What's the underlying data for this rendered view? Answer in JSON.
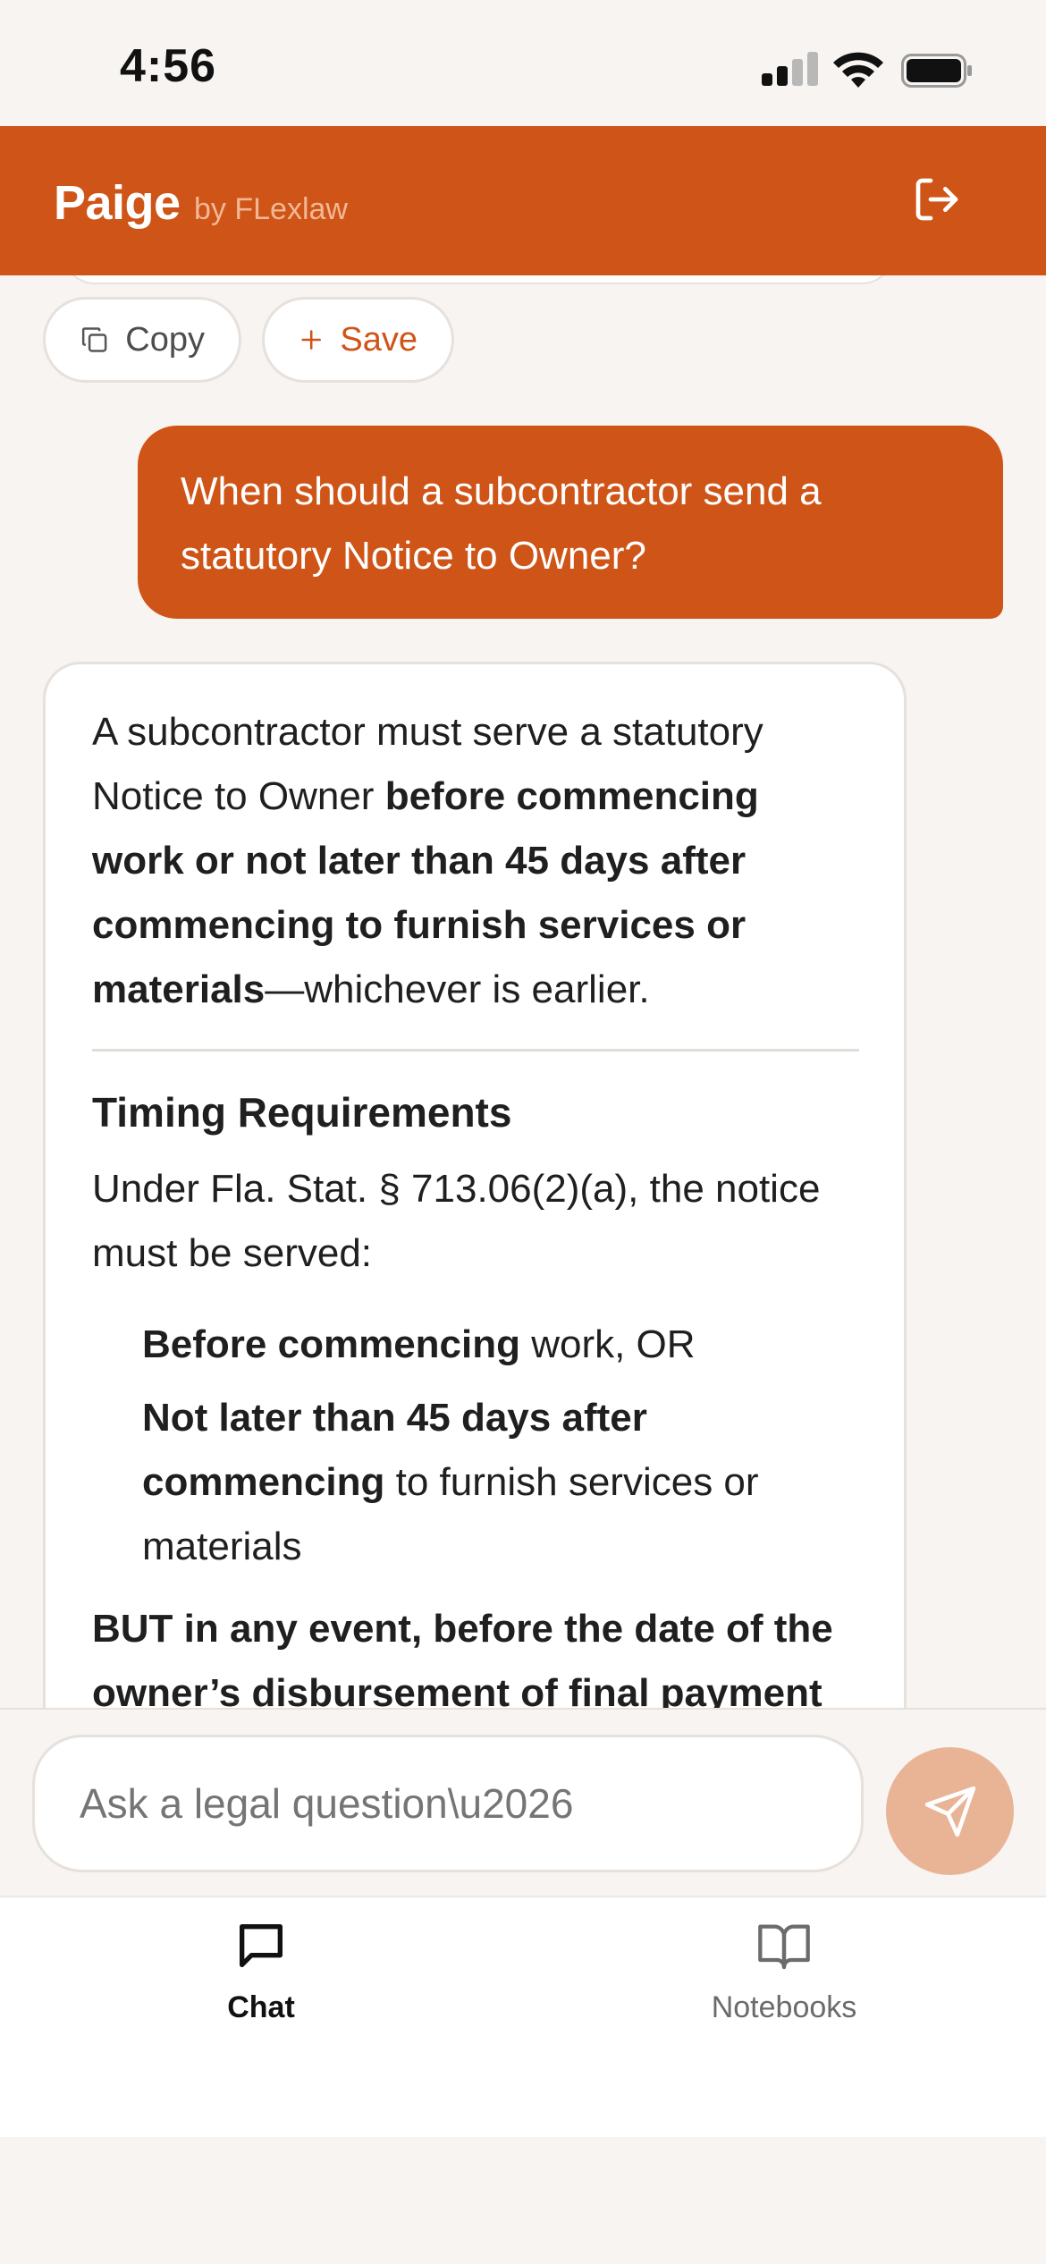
{
  "status_bar": {
    "time": "4:56",
    "icons": [
      "signal-icon",
      "wifi-icon",
      "battery-icon"
    ]
  },
  "header": {
    "title": "Paige",
    "subtitle": "by FLexlaw",
    "logout_icon": "logout-icon"
  },
  "actions": {
    "copy_label": "Copy",
    "save_label": "Save"
  },
  "user_message": "When should a subcontractor send a statutory Notice to Owner?",
  "answer": {
    "intro_plain": "A subcontractor must serve a statutory Notice to Owner ",
    "intro_bold": "before commencing work or not later than 45 days after commencing to furnish services or materials",
    "intro_tail": "—whichever is earlier.",
    "section_heading": "Timing Requirements",
    "section_text": "Under Fla. Stat. § 713.06(2)(a), the notice must be served:",
    "list": [
      {
        "bold": "Before commencing",
        "rest": " work, OR"
      },
      {
        "bold": "Not later than 45 days after commencing",
        "rest": " to furnish services or materials"
      }
    ],
    "final_line": "BUT in any event, before the date of the owner’s disbursement of final payment"
  },
  "composer": {
    "placeholder": "Ask a legal question\\u2026",
    "send_icon": "send-icon"
  },
  "tabs": [
    {
      "label": "Chat",
      "icon": "chat-icon",
      "active": true
    },
    {
      "label": "Notebooks",
      "icon": "book-icon",
      "active": false
    }
  ],
  "colors": {
    "brand": "#cf5417",
    "send_disabled": "#e9b496",
    "background": "#f7f4f1"
  }
}
